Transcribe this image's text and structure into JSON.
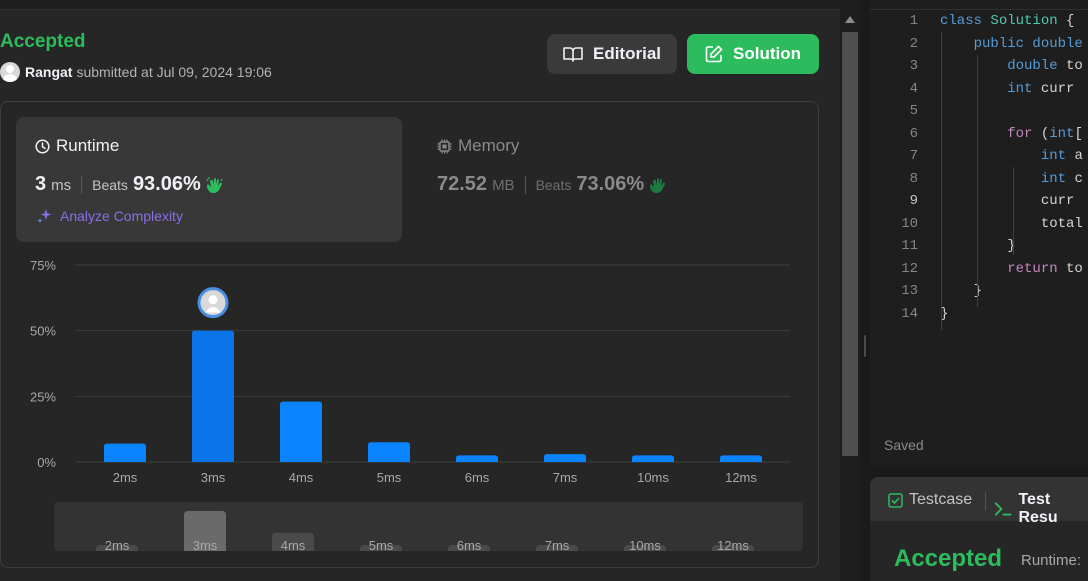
{
  "submission": {
    "status": "Accepted",
    "submitter": "Rangat",
    "submitted_text": "submitted at Jul 09, 2024 19:06"
  },
  "actions": {
    "editorial_label": "Editorial",
    "solution_label": "Solution"
  },
  "runtime": {
    "title": "Runtime",
    "value": "3",
    "unit": "ms",
    "beats_label": "Beats",
    "beats_value": "93.06%",
    "analyze_label": "Analyze Complexity"
  },
  "memory": {
    "title": "Memory",
    "value": "72.52",
    "unit": "MB",
    "beats_label": "Beats",
    "beats_value": "73.06%"
  },
  "chart_data": {
    "type": "bar",
    "categories": [
      "2ms",
      "3ms",
      "4ms",
      "5ms",
      "6ms",
      "7ms",
      "10ms",
      "12ms"
    ],
    "values": [
      7,
      50,
      23,
      7.5,
      2.5,
      3,
      2.5,
      2.5
    ],
    "yticks": [
      "0%",
      "25%",
      "50%",
      "75%"
    ],
    "ylim": [
      0,
      75
    ],
    "highlight_category": "3ms",
    "navigator_labels": [
      "2ms",
      "3ms",
      "4ms",
      "5ms",
      "6ms",
      "7ms",
      "10ms",
      "12ms"
    ],
    "colors": {
      "bar": "#0a84ff",
      "highlight": "#0a74e8",
      "grid": "#3e3e3e"
    }
  },
  "editor": {
    "lines": [
      {
        "n": "1",
        "tokens": [
          [
            "kw",
            "class "
          ],
          [
            "cls",
            "Solution "
          ],
          [
            "",
            "{"
          ]
        ]
      },
      {
        "n": "2",
        "tokens": [
          [
            "",
            "    "
          ],
          [
            "kw",
            "public "
          ],
          [
            "kw",
            "double"
          ]
        ]
      },
      {
        "n": "3",
        "tokens": [
          [
            "",
            "        "
          ],
          [
            "kw",
            "double "
          ],
          [
            "",
            "to"
          ]
        ]
      },
      {
        "n": "4",
        "tokens": [
          [
            "",
            "        "
          ],
          [
            "kw",
            "int "
          ],
          [
            "",
            "curr"
          ]
        ]
      },
      {
        "n": "5",
        "tokens": []
      },
      {
        "n": "6",
        "tokens": [
          [
            "",
            "        "
          ],
          [
            "kw2",
            "for "
          ],
          [
            "",
            "("
          ],
          [
            "kw",
            "int"
          ],
          [
            "",
            "["
          ]
        ]
      },
      {
        "n": "7",
        "tokens": [
          [
            "",
            "            "
          ],
          [
            "kw",
            "int "
          ],
          [
            "",
            "a"
          ]
        ]
      },
      {
        "n": "8",
        "tokens": [
          [
            "",
            "            "
          ],
          [
            "kw",
            "int "
          ],
          [
            "",
            "c"
          ]
        ]
      },
      {
        "n": "9",
        "tokens": [
          [
            "",
            "            curr"
          ]
        ]
      },
      {
        "n": "10",
        "tokens": [
          [
            "",
            "            total"
          ]
        ]
      },
      {
        "n": "11",
        "tokens": [
          [
            "",
            "        }"
          ]
        ]
      },
      {
        "n": "12",
        "tokens": [
          [
            "",
            "        "
          ],
          [
            "kw2",
            "return "
          ],
          [
            "",
            "to"
          ]
        ]
      },
      {
        "n": "13",
        "tokens": [
          [
            "",
            "    }"
          ]
        ]
      },
      {
        "n": "14",
        "tokens": [
          [
            "",
            "}"
          ]
        ]
      }
    ],
    "active_line": "9",
    "saved_label": "Saved"
  },
  "test_panel": {
    "tab_testcase": "Testcase",
    "tab_result": "Test Resu",
    "result_status": "Accepted",
    "runtime_label": "Runtime:"
  }
}
